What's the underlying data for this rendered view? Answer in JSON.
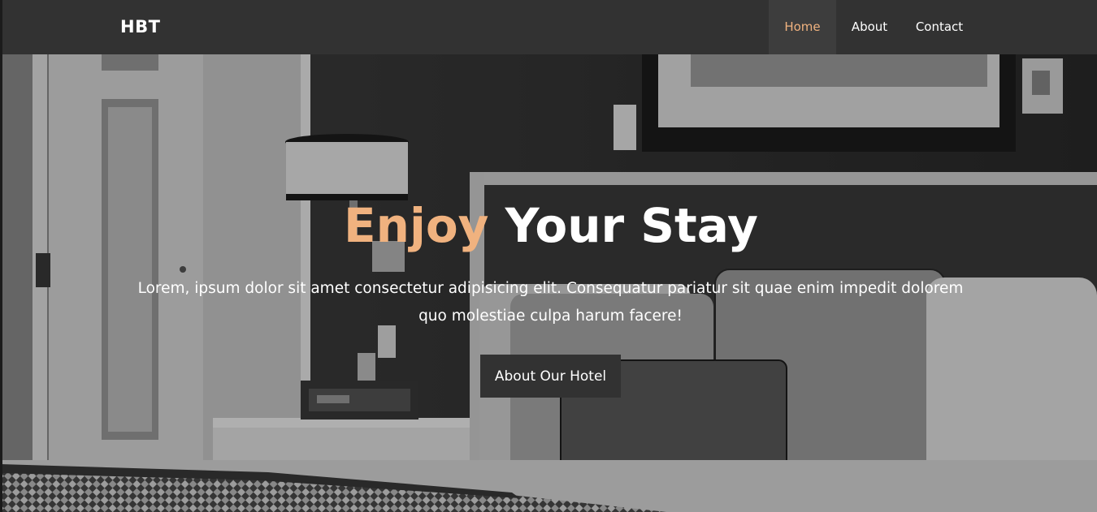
{
  "navbar": {
    "brand": "HBT",
    "items": [
      {
        "label": "Home",
        "active": true
      },
      {
        "label": "About",
        "active": false
      },
      {
        "label": "Contact",
        "active": false
      }
    ]
  },
  "hero": {
    "title_accent": "Enjoy",
    "title_rest": " Your Stay",
    "text": "Lorem, ipsum dolor sit amet consectetur adipisicing elit. Consequatur pariatur sit quae enim impedit dolorem quo molestiae culpa harum facere!",
    "button_label": "About Our Hotel"
  },
  "colors": {
    "accent": "#f0b27f",
    "navbar_bg": "#323232",
    "active_nav_bg": "#3d3d3d",
    "button_bg": "#323232"
  }
}
